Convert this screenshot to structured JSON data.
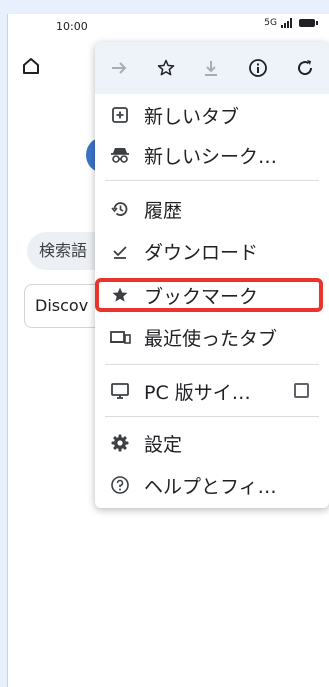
{
  "status_bar": {
    "time": "10:00",
    "signal_text": "5G"
  },
  "page": {
    "search_placeholder": "検索語",
    "discover_label": "Discov"
  },
  "menu": {
    "toolbar": [
      {
        "icon": "forward-icon"
      },
      {
        "icon": "bookmark-star-icon"
      },
      {
        "icon": "download-icon"
      },
      {
        "icon": "info-icon"
      },
      {
        "icon": "reload-icon"
      }
    ],
    "items": [
      {
        "label": "新しいタブ",
        "icon": "new-tab-icon"
      },
      {
        "label": "新しいシーク…",
        "icon": "incognito-icon"
      },
      {
        "label": "履歴",
        "icon": "history-icon"
      },
      {
        "label": "ダウンロード",
        "icon": "downloads-icon"
      },
      {
        "label": "ブックマーク",
        "icon": "bookmarks-star-icon"
      },
      {
        "label": "最近使ったタブ",
        "icon": "recent-tabs-icon"
      },
      {
        "label": "PC 版サイ…",
        "icon": "desktop-icon"
      },
      {
        "label": "設定",
        "icon": "settings-gear-icon"
      },
      {
        "label": "ヘルプとフィ…",
        "icon": "help-icon"
      }
    ]
  },
  "colors": {
    "highlight": "#e8342a",
    "toolbar_bg": "#eef2f9",
    "accent_blue": "#3c74c8"
  }
}
